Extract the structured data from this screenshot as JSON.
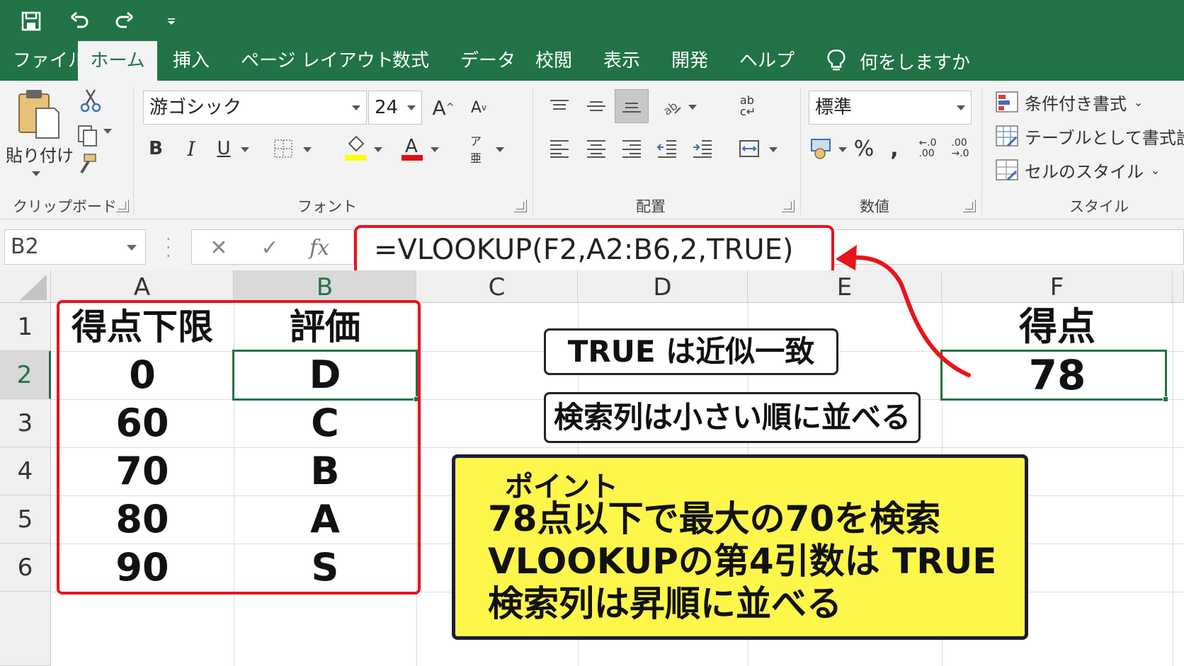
{
  "colors": {
    "excel_green": "#217346",
    "red_annot": "#e8141b",
    "note_yellow": "#fff64c"
  },
  "qat": {
    "icons": [
      "save-icon",
      "undo-icon",
      "redo-icon",
      "customize-qat-icon"
    ]
  },
  "tabs": [
    "ファイル",
    "ホーム",
    "挿入",
    "ページ レイアウト",
    "数式",
    "データ",
    "校閲",
    "表示",
    "開発",
    "ヘルプ"
  ],
  "active_tab": "ホーム",
  "tellme": {
    "label": "何をしますか",
    "icon": "lightbulb-icon"
  },
  "ribbon": {
    "clipboard": {
      "paste_label": "貼り付け",
      "group_label": "クリップボード"
    },
    "font": {
      "font_name": "游ゴシック",
      "font_size": "24",
      "group_label": "フォント"
    },
    "alignment": {
      "group_label": "配置"
    },
    "number": {
      "format": "標準",
      "group_label": "数値"
    },
    "styles": {
      "conditional": "条件付き書式",
      "as_table": "テーブルとして書式設定",
      "cell_styles": "セルのスタイル",
      "group_label": "スタイル"
    }
  },
  "formula_bar": {
    "name_box": "B2",
    "fx_label": "fx",
    "formula": "=VLOOKUP(F2,A2:B6,2,TRUE)"
  },
  "sheet": {
    "columns": [
      "A",
      "B",
      "C",
      "D",
      "E",
      "F"
    ],
    "rows": [
      "1",
      "2",
      "3",
      "4",
      "5",
      "6"
    ],
    "active_cell": "B2",
    "table_header": {
      "a": "得点下限",
      "b": "評価"
    },
    "table_rows": [
      {
        "a": "0",
        "b": "D"
      },
      {
        "a": "60",
        "b": "C"
      },
      {
        "a": "70",
        "b": "B"
      },
      {
        "a": "80",
        "b": "A"
      },
      {
        "a": "90",
        "b": "S"
      }
    ],
    "f1": "得点",
    "f2": "78"
  },
  "notes": {
    "true_note": "TRUE は近似一致",
    "sort_note": "検索列は小さい順に並べる"
  },
  "point": {
    "title": "ポイント",
    "lines": [
      "78点以下で最大の70を検索",
      "VLOOKUPの第4引数は TRUE",
      "検索列は昇順に並べる"
    ]
  }
}
